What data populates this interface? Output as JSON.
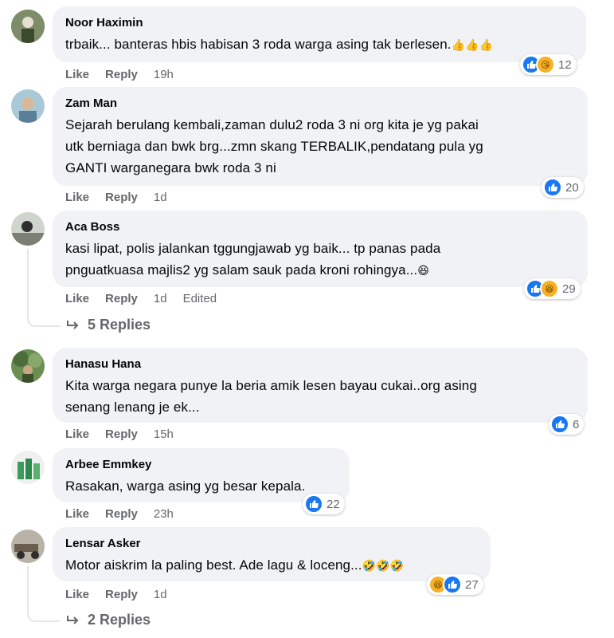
{
  "comments": [
    {
      "author": "Noor Haximin",
      "text": "trbaik... banteras hbis habisan 3 roda warga asing tak berlesen.",
      "emojis": "👍👍👍",
      "like_label": "Like",
      "reply_label": "Reply",
      "time": "19h",
      "reaction_count": "12",
      "reactions": [
        "like-icon",
        "care-icon"
      ]
    },
    {
      "author": "Zam Man",
      "text_lines": [
        "Sejarah berulang kembali,zaman dulu2 roda 3 ni org kita je yg pakai",
        "utk berniaga dan bwk brg...zmn skang TERBALIK,pendatang pula yg",
        "GANTI warganegara bwk roda 3 ni"
      ],
      "like_label": "Like",
      "reply_label": "Reply",
      "time": "1d",
      "reaction_count": "20",
      "reactions": [
        "like-icon"
      ]
    },
    {
      "author": "Aca Boss",
      "text_lines": [
        "kasi lipat, polis jalankan tggungjawab yg baik... tp panas pada",
        "pnguatkuasa majlis2 yg salam sauk pada kroni rohingya..."
      ],
      "emojis": "😆",
      "like_label": "Like",
      "reply_label": "Reply",
      "time": "1d",
      "edited": "Edited",
      "reaction_count": "29",
      "reactions": [
        "like-icon",
        "haha-icon"
      ],
      "replies_label": "5 Replies"
    },
    {
      "author": "Hanasu Hana",
      "text_lines": [
        "Kita warga negara punye la beria amik lesen bayau cukai..org asing",
        "senang lenang je ek..."
      ],
      "like_label": "Like",
      "reply_label": "Reply",
      "time": "15h",
      "reaction_count": "6",
      "reactions": [
        "like-icon"
      ]
    },
    {
      "author": "Arbee Emmkey",
      "text": "Rasakan, warga asing yg besar kepala.",
      "like_label": "Like",
      "reply_label": "Reply",
      "time": "23h",
      "reaction_count": "22",
      "reactions": [
        "like-icon"
      ]
    },
    {
      "author": "Lensar Asker",
      "text": "Motor aiskrim la paling best. Ade lagu & loceng...",
      "emojis": "🤣🤣🤣",
      "like_label": "Like",
      "reply_label": "Reply",
      "time": "1d",
      "reaction_count": "27",
      "reactions": [
        "haha-icon",
        "like-icon"
      ],
      "replies_label": "2 Replies"
    }
  ],
  "colors": {
    "bubble": "#f0f2f5",
    "meta": "#65676b",
    "like_blue": "#1877f2",
    "haha_yellow": "#f7b125"
  }
}
